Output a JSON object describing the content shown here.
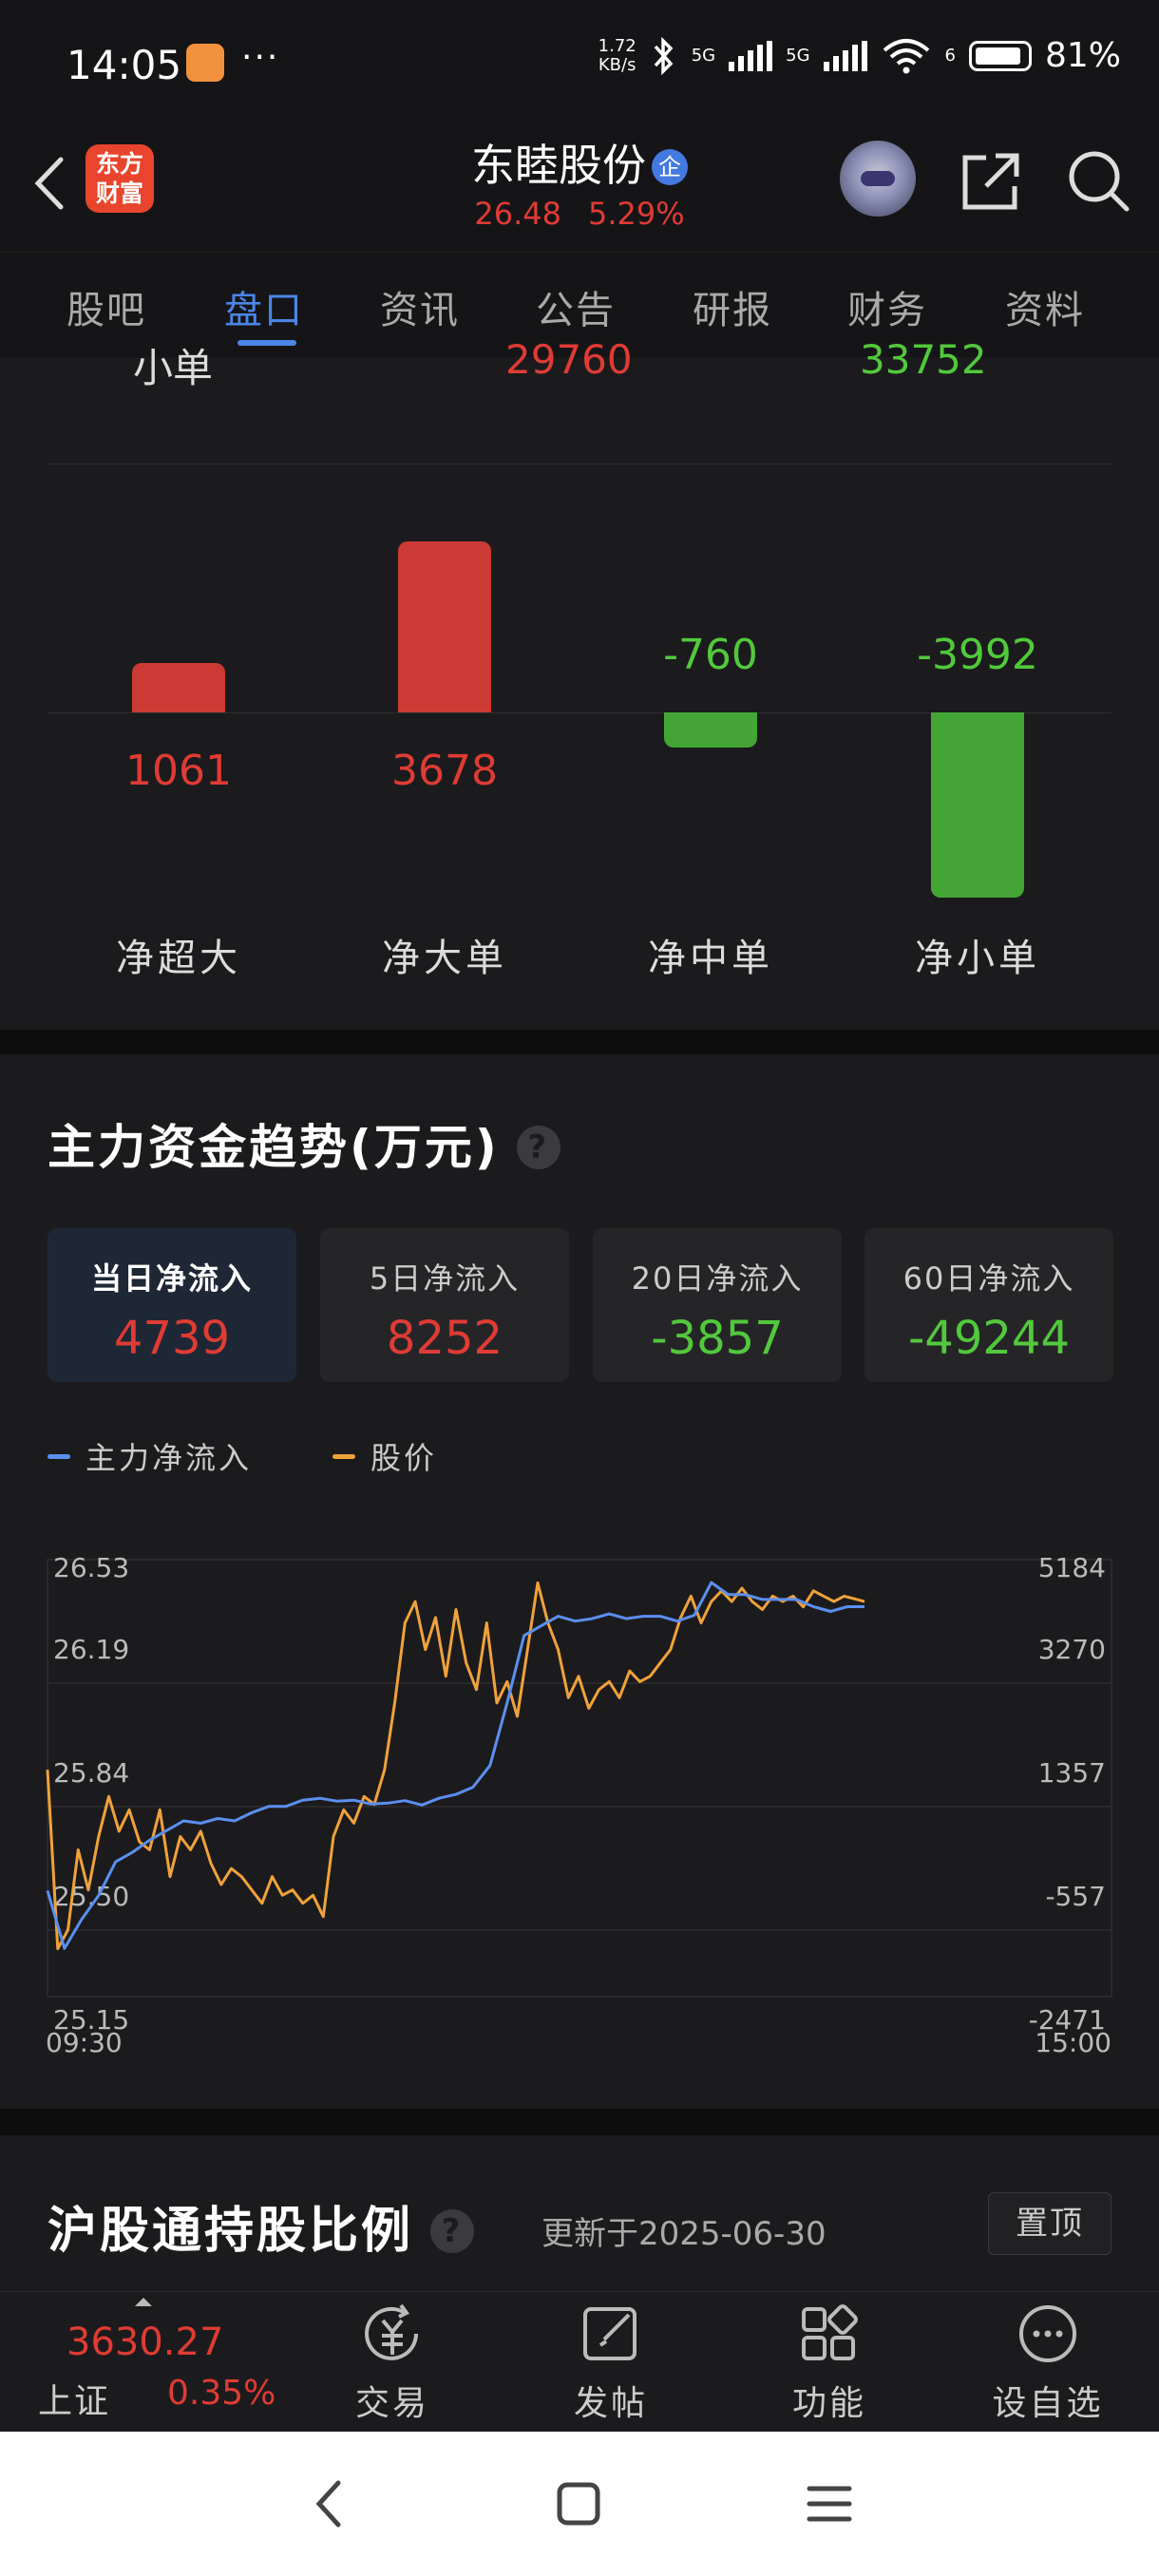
{
  "status_bar": {
    "time": "14:05",
    "dots": "···",
    "net_speed_value": "1.72",
    "net_speed_unit": "KB/s",
    "sim1": "5G",
    "sim2": "5G",
    "wifi_badge": "6",
    "battery": "81%"
  },
  "header": {
    "logo_line1": "东方",
    "logo_line2": "财富",
    "stock_name": "东睦股份",
    "badge": "企",
    "price": "26.48",
    "change_pct": "5.29%"
  },
  "tabs": [
    "股吧",
    "盘口",
    "资讯",
    "公告",
    "研报",
    "财务",
    "资料"
  ],
  "active_tab": 1,
  "order_flow": {
    "partial_row": {
      "label": "小单",
      "buy": "29760",
      "sell": "33752"
    },
    "items": [
      {
        "label": "净超大",
        "value": "1061",
        "num": 1061
      },
      {
        "label": "净大单",
        "value": "3678",
        "num": 3678
      },
      {
        "label": "净中单",
        "value": "-760",
        "num": -760
      },
      {
        "label": "净小单",
        "value": "-3992",
        "num": -3992
      }
    ],
    "colors": {
      "positive": "#cc3a35",
      "negative": "#43a634"
    }
  },
  "trend": {
    "title": "主力资金趋势(万元)",
    "help": "?",
    "cards": [
      {
        "label": "当日净流入",
        "value": "4739"
      },
      {
        "label": "5日净流入",
        "value": "8252"
      },
      {
        "label": "20日净流入",
        "value": "-3857"
      },
      {
        "label": "60日净流入",
        "value": "-49244"
      }
    ],
    "legend": {
      "flow": "主力净流入",
      "price": "股价"
    },
    "colors": {
      "flow": "#5b8ff0",
      "price": "#f0a23a"
    }
  },
  "chart_data": {
    "type": "line",
    "x_start": "09:30",
    "x_end": "15:00",
    "left_ticks": [
      "26.53",
      "26.19",
      "25.84",
      "25.50",
      "25.15"
    ],
    "right_ticks": [
      "5184",
      "3270",
      "1357",
      "-557",
      "-2471"
    ],
    "left_range": [
      25.15,
      26.53
    ],
    "right_range": [
      -2471,
      5184
    ],
    "series": [
      {
        "name": "主力净流入",
        "x": [
          0,
          5,
          10,
          15,
          20,
          25,
          30,
          35,
          40,
          45,
          50,
          55,
          60,
          65,
          70,
          75,
          80,
          85,
          90,
          95,
          100,
          105,
          110,
          115,
          120,
          125,
          130,
          135,
          140,
          145,
          150,
          155,
          160,
          165,
          170,
          175,
          180,
          185,
          190,
          195,
          200,
          205,
          210,
          215,
          220,
          225,
          230,
          235,
          240
        ],
        "y": [
          -1100,
          -2300,
          -1700,
          -1200,
          -500,
          -300,
          -50,
          150,
          350,
          300,
          400,
          350,
          520,
          650,
          650,
          780,
          820,
          760,
          780,
          700,
          720,
          770,
          680,
          820,
          900,
          1050,
          1500,
          2800,
          4200,
          4400,
          4600,
          4500,
          4550,
          4650,
          4550,
          4600,
          4600,
          4500,
          4620,
          5300,
          5050,
          5050,
          4950,
          4950,
          4950,
          4800,
          4700,
          4800,
          4800
        ]
      },
      {
        "name": "股价",
        "x": [
          0,
          3,
          6,
          9,
          12,
          15,
          18,
          21,
          24,
          27,
          30,
          33,
          36,
          39,
          42,
          45,
          48,
          51,
          54,
          57,
          60,
          63,
          66,
          69,
          72,
          75,
          78,
          81,
          84,
          87,
          90,
          93,
          96,
          99,
          102,
          105,
          108,
          111,
          114,
          117,
          120,
          123,
          126,
          129,
          132,
          135,
          138,
          141,
          144,
          147,
          150,
          153,
          156,
          159,
          162,
          165,
          168,
          171,
          174,
          177,
          180,
          183,
          186,
          189,
          192,
          195,
          198,
          201,
          204,
          207,
          210,
          213,
          216,
          219,
          222,
          225,
          228,
          231,
          234,
          237,
          240
        ],
        "y": [
          25.85,
          25.18,
          25.25,
          25.55,
          25.4,
          25.6,
          25.75,
          25.62,
          25.7,
          25.58,
          25.55,
          25.7,
          25.45,
          25.6,
          25.55,
          25.62,
          25.5,
          25.42,
          25.48,
          25.45,
          25.4,
          25.35,
          25.45,
          25.38,
          25.4,
          25.35,
          25.38,
          25.3,
          25.6,
          25.7,
          25.65,
          25.75,
          25.72,
          25.85,
          26.1,
          26.4,
          26.48,
          26.3,
          26.42,
          26.2,
          26.45,
          26.25,
          26.15,
          26.4,
          26.1,
          26.18,
          26.05,
          26.3,
          26.55,
          26.4,
          26.3,
          26.12,
          26.2,
          26.08,
          26.15,
          26.18,
          26.12,
          26.22,
          26.18,
          26.2,
          26.25,
          26.3,
          26.42,
          26.5,
          26.4,
          26.48,
          26.52,
          26.48,
          26.53,
          26.48,
          26.45,
          26.5,
          26.48,
          26.5,
          26.46,
          26.52,
          26.5,
          26.48,
          26.5,
          26.49,
          26.48
        ]
      }
    ]
  },
  "hk_holding": {
    "title": "沪股通持股比例",
    "help": "?",
    "updated": "更新于2025-06-30",
    "pin": "置顶"
  },
  "bottom_bar": {
    "index_value": "3630.27",
    "index_name": "上证",
    "index_pct": "0.35%",
    "items": [
      {
        "label": "交易"
      },
      {
        "label": "发帖"
      },
      {
        "label": "功能"
      },
      {
        "label": "设自选"
      }
    ]
  }
}
